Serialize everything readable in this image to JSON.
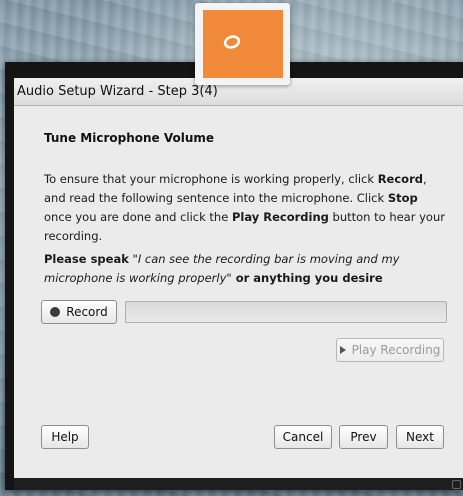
{
  "window": {
    "title": "Audio Setup Wizard - Step 3(4)"
  },
  "content": {
    "heading": "Tune Microphone Volume",
    "instructions": {
      "p1": "To ensure that your microphone is working properly, click ",
      "record_bold": "Record",
      "p2": ", and read the following sentence into the microphone. Click ",
      "stop_bold": "Stop",
      "p3": " once you are done and click the ",
      "play_bold": "Play Recording",
      "p4": " button to hear your recording."
    },
    "speak": {
      "prefix": "Please speak",
      "quote": "\"I can see the recording bar is moving and my microphone is working properly\"",
      "suffix": " or anything you desire"
    }
  },
  "controls": {
    "record_label": "Record",
    "recording_level": 0,
    "play_recording_label": "Play Recording"
  },
  "footer": {
    "help_label": "Help",
    "cancel_label": "Cancel",
    "prev_label": "Prev",
    "next_label": "Next"
  },
  "colors": {
    "logo_accent": "#f08a3a",
    "dialog_background": "#ebebeb"
  },
  "icons": {
    "logo": "orange-app-logo-icon",
    "record": "record-dot-icon",
    "play": "play-triangle-icon",
    "resize": "resize-grip-icon"
  }
}
